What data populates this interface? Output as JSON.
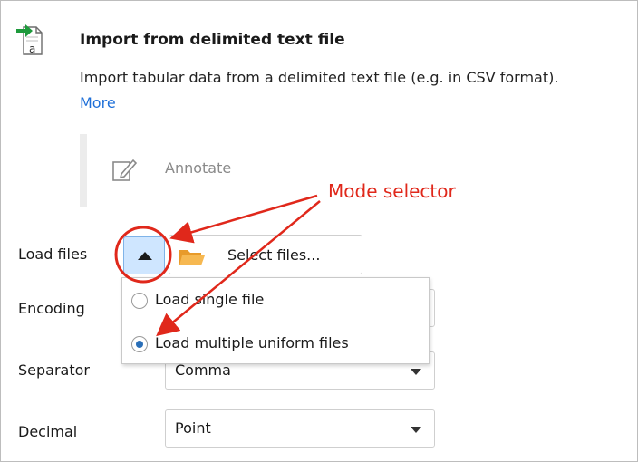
{
  "step": {
    "icon": "import-text-file-icon",
    "title": "Import from delimited text file",
    "description": "Import tabular data from a delimited text file (e.g. in CSV format).",
    "more_link": "More"
  },
  "annotate": {
    "icon": "pencil-annotate-icon",
    "label": "Annotate"
  },
  "load_files": {
    "label": "Load files",
    "mode_button_icon": "triangle-up-icon",
    "select_button": {
      "icon": "folder-open-icon",
      "label": "Select files..."
    }
  },
  "mode_popup": {
    "options": [
      {
        "label": "Load single file",
        "selected": false
      },
      {
        "label": "Load multiple uniform files",
        "selected": true
      }
    ]
  },
  "encoding": {
    "label": "Encoding",
    "value": ""
  },
  "separator": {
    "label": "Separator",
    "value": "Comma"
  },
  "decimal": {
    "label": "Decimal",
    "value": "Point"
  },
  "callout": {
    "text": "Mode selector",
    "color": "#e0281b"
  },
  "colors": {
    "accent": "#1e6fd8",
    "mode_button_bg": "#cfe6ff",
    "callout": "#e0281b"
  }
}
